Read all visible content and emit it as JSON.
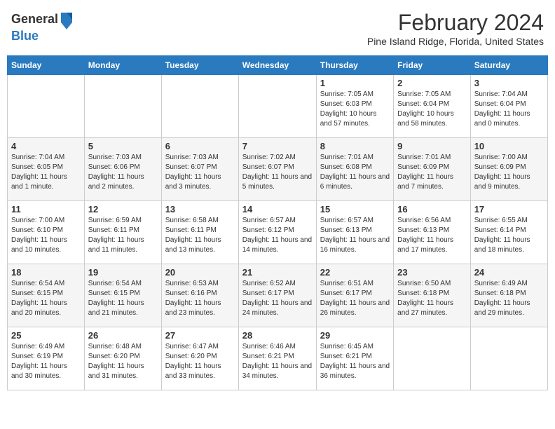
{
  "header": {
    "logo_general": "General",
    "logo_blue": "Blue",
    "month_title": "February 2024",
    "location": "Pine Island Ridge, Florida, United States"
  },
  "days_of_week": [
    "Sunday",
    "Monday",
    "Tuesday",
    "Wednesday",
    "Thursday",
    "Friday",
    "Saturday"
  ],
  "weeks": [
    [
      {
        "day": "",
        "info": ""
      },
      {
        "day": "",
        "info": ""
      },
      {
        "day": "",
        "info": ""
      },
      {
        "day": "",
        "info": ""
      },
      {
        "day": "1",
        "info": "Sunrise: 7:05 AM\nSunset: 6:03 PM\nDaylight: 10 hours and 57 minutes."
      },
      {
        "day": "2",
        "info": "Sunrise: 7:05 AM\nSunset: 6:04 PM\nDaylight: 10 hours and 58 minutes."
      },
      {
        "day": "3",
        "info": "Sunrise: 7:04 AM\nSunset: 6:04 PM\nDaylight: 11 hours and 0 minutes."
      }
    ],
    [
      {
        "day": "4",
        "info": "Sunrise: 7:04 AM\nSunset: 6:05 PM\nDaylight: 11 hours and 1 minute."
      },
      {
        "day": "5",
        "info": "Sunrise: 7:03 AM\nSunset: 6:06 PM\nDaylight: 11 hours and 2 minutes."
      },
      {
        "day": "6",
        "info": "Sunrise: 7:03 AM\nSunset: 6:07 PM\nDaylight: 11 hours and 3 minutes."
      },
      {
        "day": "7",
        "info": "Sunrise: 7:02 AM\nSunset: 6:07 PM\nDaylight: 11 hours and 5 minutes."
      },
      {
        "day": "8",
        "info": "Sunrise: 7:01 AM\nSunset: 6:08 PM\nDaylight: 11 hours and 6 minutes."
      },
      {
        "day": "9",
        "info": "Sunrise: 7:01 AM\nSunset: 6:09 PM\nDaylight: 11 hours and 7 minutes."
      },
      {
        "day": "10",
        "info": "Sunrise: 7:00 AM\nSunset: 6:09 PM\nDaylight: 11 hours and 9 minutes."
      }
    ],
    [
      {
        "day": "11",
        "info": "Sunrise: 7:00 AM\nSunset: 6:10 PM\nDaylight: 11 hours and 10 minutes."
      },
      {
        "day": "12",
        "info": "Sunrise: 6:59 AM\nSunset: 6:11 PM\nDaylight: 11 hours and 11 minutes."
      },
      {
        "day": "13",
        "info": "Sunrise: 6:58 AM\nSunset: 6:11 PM\nDaylight: 11 hours and 13 minutes."
      },
      {
        "day": "14",
        "info": "Sunrise: 6:57 AM\nSunset: 6:12 PM\nDaylight: 11 hours and 14 minutes."
      },
      {
        "day": "15",
        "info": "Sunrise: 6:57 AM\nSunset: 6:13 PM\nDaylight: 11 hours and 16 minutes."
      },
      {
        "day": "16",
        "info": "Sunrise: 6:56 AM\nSunset: 6:13 PM\nDaylight: 11 hours and 17 minutes."
      },
      {
        "day": "17",
        "info": "Sunrise: 6:55 AM\nSunset: 6:14 PM\nDaylight: 11 hours and 18 minutes."
      }
    ],
    [
      {
        "day": "18",
        "info": "Sunrise: 6:54 AM\nSunset: 6:15 PM\nDaylight: 11 hours and 20 minutes."
      },
      {
        "day": "19",
        "info": "Sunrise: 6:54 AM\nSunset: 6:15 PM\nDaylight: 11 hours and 21 minutes."
      },
      {
        "day": "20",
        "info": "Sunrise: 6:53 AM\nSunset: 6:16 PM\nDaylight: 11 hours and 23 minutes."
      },
      {
        "day": "21",
        "info": "Sunrise: 6:52 AM\nSunset: 6:17 PM\nDaylight: 11 hours and 24 minutes."
      },
      {
        "day": "22",
        "info": "Sunrise: 6:51 AM\nSunset: 6:17 PM\nDaylight: 11 hours and 26 minutes."
      },
      {
        "day": "23",
        "info": "Sunrise: 6:50 AM\nSunset: 6:18 PM\nDaylight: 11 hours and 27 minutes."
      },
      {
        "day": "24",
        "info": "Sunrise: 6:49 AM\nSunset: 6:18 PM\nDaylight: 11 hours and 29 minutes."
      }
    ],
    [
      {
        "day": "25",
        "info": "Sunrise: 6:49 AM\nSunset: 6:19 PM\nDaylight: 11 hours and 30 minutes."
      },
      {
        "day": "26",
        "info": "Sunrise: 6:48 AM\nSunset: 6:20 PM\nDaylight: 11 hours and 31 minutes."
      },
      {
        "day": "27",
        "info": "Sunrise: 6:47 AM\nSunset: 6:20 PM\nDaylight: 11 hours and 33 minutes."
      },
      {
        "day": "28",
        "info": "Sunrise: 6:46 AM\nSunset: 6:21 PM\nDaylight: 11 hours and 34 minutes."
      },
      {
        "day": "29",
        "info": "Sunrise: 6:45 AM\nSunset: 6:21 PM\nDaylight: 11 hours and 36 minutes."
      },
      {
        "day": "",
        "info": ""
      },
      {
        "day": "",
        "info": ""
      }
    ]
  ]
}
